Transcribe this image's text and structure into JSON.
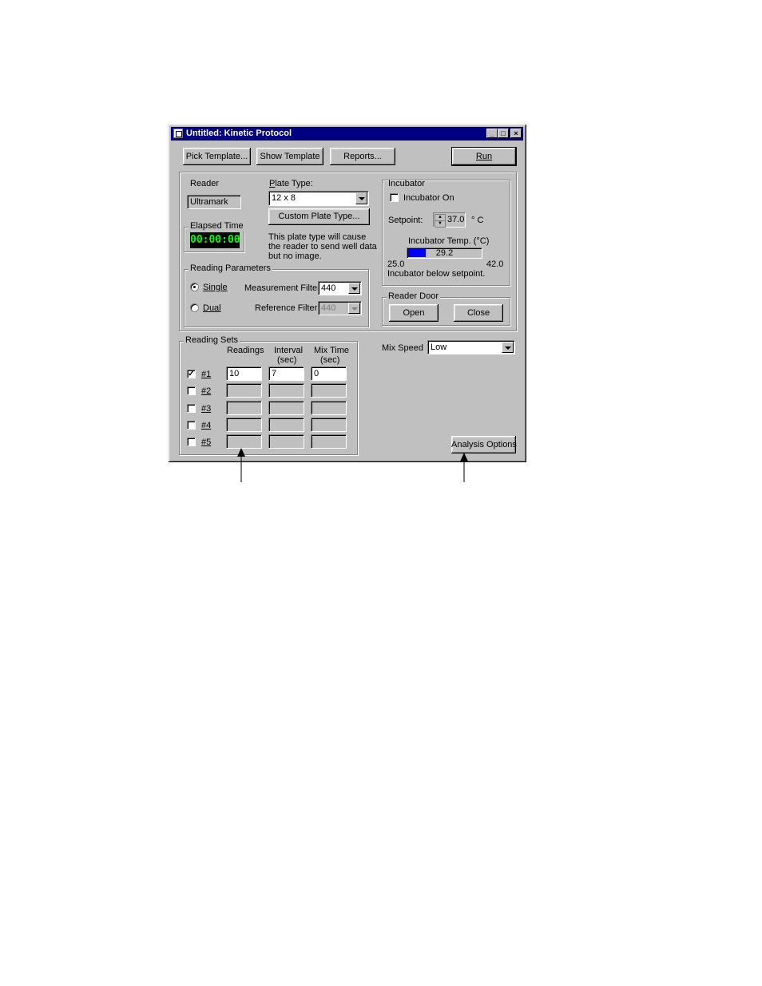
{
  "window": {
    "title": "Untitled: Kinetic Protocol",
    "controls": [
      "_",
      "□",
      "×"
    ]
  },
  "toolbar": {
    "pick_template": "Pick Template...",
    "show_template": "Show Template",
    "reports": "Reports...",
    "run": "Run"
  },
  "reader": {
    "group_label": "Reader",
    "value": "Ultramark"
  },
  "elapsed": {
    "group_label": "Elapsed Time",
    "value": "00:00:00"
  },
  "plate": {
    "label": "Plate Type:",
    "value": "12 x 8",
    "custom_button": "Custom Plate Type...",
    "note_line1": "This plate type will cause",
    "note_line2": "the reader to send well data",
    "note_line3": "but no image."
  },
  "reading_params": {
    "group_label": "Reading Parameters",
    "single": "Single",
    "dual": "Dual",
    "selected": "Single",
    "measurement_label": "Measurement Filter:",
    "measurement_value": "440",
    "reference_label": "Reference Filter:",
    "reference_value": "440"
  },
  "incubator": {
    "group_label": "Incubator",
    "on_label": "Incubator On",
    "on_checked": false,
    "setpoint_label": "Setpoint:",
    "setpoint_value": "37.0",
    "unit": "° C",
    "temp_label": "Incubator Temp. (°C)",
    "temp_value": "29.2",
    "temp_level": 0.242,
    "min": "25.0",
    "max": "42.0",
    "status": "Incubator below setpoint.",
    "bar_color": "#0000ff"
  },
  "reader_door": {
    "group_label": "Reader Door",
    "open": "Open",
    "close": "Close"
  },
  "reading_sets": {
    "group_label": "Reading Sets",
    "headers": {
      "readings": "Readings",
      "interval_1": "Interval",
      "interval_2": "(sec)",
      "mix_1": "Mix Time",
      "mix_2": "(sec)"
    },
    "rows": [
      {
        "label": "#1",
        "checked": true,
        "readings": "10",
        "interval": "7",
        "mix": "0"
      },
      {
        "label": "#2",
        "checked": false,
        "readings": "",
        "interval": "",
        "mix": ""
      },
      {
        "label": "#3",
        "checked": false,
        "readings": "",
        "interval": "",
        "mix": ""
      },
      {
        "label": "#4",
        "checked": false,
        "readings": "",
        "interval": "",
        "mix": ""
      },
      {
        "label": "#5",
        "checked": false,
        "readings": "",
        "interval": "",
        "mix": ""
      }
    ]
  },
  "mix_speed": {
    "label": "Mix Speed",
    "value": "Low"
  },
  "analysis_options": "Analysis Options",
  "colors": {
    "titlebar": "#000080",
    "face": "#c0c0c0",
    "led_text": "#00ff00"
  }
}
